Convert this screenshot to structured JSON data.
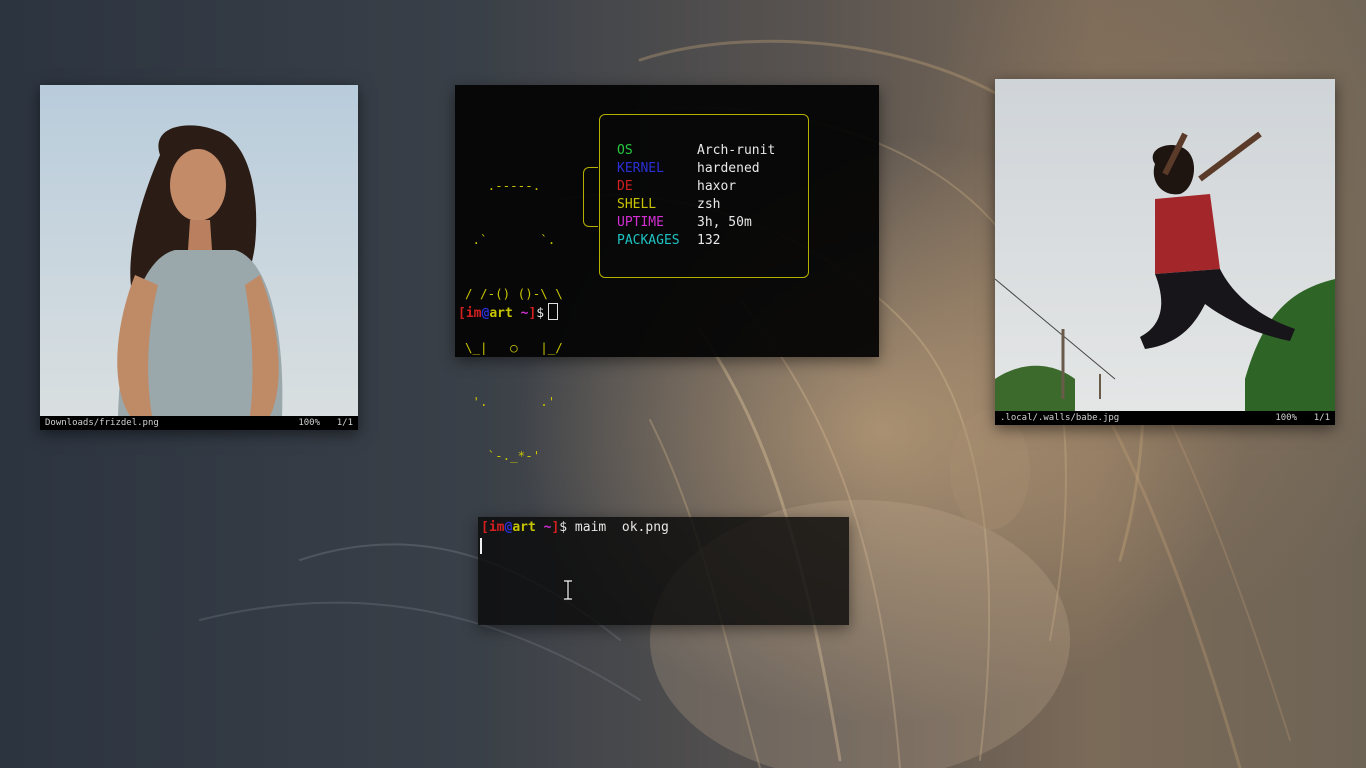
{
  "viewer_left": {
    "path": "Downloads/frizdel.png",
    "zoom": "100%",
    "page": "1/1"
  },
  "viewer_right": {
    "path": ".local/.walls/babe.jpg",
    "zoom": "100%",
    "page": "1/1"
  },
  "fetch_terminal": {
    "ascii_logo": [
      "   .-----.",
      " .`       `.",
      "/ /-() ()-\\ \\",
      "\\_|   ○   |_/",
      " '.       .'",
      "   `-._*-'"
    ],
    "info": [
      {
        "key": "OS",
        "value": "Arch-runit",
        "color": "#27c93f"
      },
      {
        "key": "KERNEL",
        "value": "hardened",
        "color": "#2a2fd6"
      },
      {
        "key": "DE",
        "value": "haxor",
        "color": "#d41f1f"
      },
      {
        "key": "SHELL",
        "value": "zsh",
        "color": "#c8c400"
      },
      {
        "key": "UPTIME",
        "value": "3h, 50m",
        "color": "#d12fd1"
      },
      {
        "key": "PACKAGES",
        "value": "132",
        "color": "#1fc2c2"
      }
    ],
    "prompt": {
      "open": "[",
      "user": "im",
      "at": "@",
      "host": "art",
      "dir": " ~",
      "close": "]",
      "symbol": "$"
    }
  },
  "command_terminal": {
    "prompt": {
      "open": "[",
      "user": "im",
      "at": "@",
      "host": "art",
      "dir": " ~",
      "close": "]",
      "symbol": "$"
    },
    "command": " maim  ok.png"
  },
  "colors": {
    "prompt_bracket": "#d41f1f",
    "prompt_user": "#d41f1f",
    "prompt_at": "#2a2fd6",
    "prompt_host": "#c8c400",
    "prompt_dir": "#d12fd1"
  }
}
